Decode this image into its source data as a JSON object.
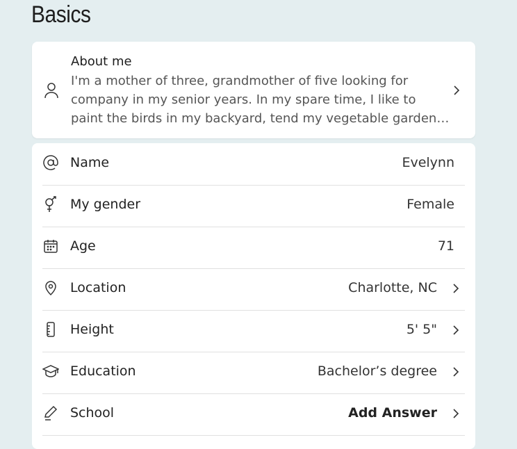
{
  "section": {
    "title": "Basics"
  },
  "about": {
    "heading": "About me",
    "text": "I'm a mother of three, grandmother of five looking for company in my senior years. In my spare time, I like to paint the birds in my backyard, tend my vegetable garden, and spend time with my family."
  },
  "rows": [
    {
      "label": "Name",
      "value": "Evelynn",
      "icon": "at-sign-icon"
    },
    {
      "label": "My gender",
      "value": "Female",
      "icon": "gender-icon"
    },
    {
      "label": "Age",
      "value": "71",
      "icon": "calendar-icon"
    },
    {
      "label": "Location",
      "value": "Charlotte, NC",
      "icon": "location-pin-icon"
    },
    {
      "label": "Height",
      "value": "5' 5\"",
      "icon": "ruler-icon"
    },
    {
      "label": "Education",
      "value": "Bachelor’s degree",
      "icon": "graduation-cap-icon"
    },
    {
      "label": "School",
      "value": "Add Answer",
      "icon": "pencil-icon"
    }
  ]
}
